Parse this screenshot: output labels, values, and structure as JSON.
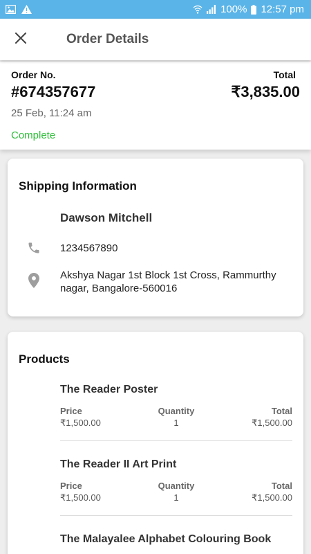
{
  "status_bar": {
    "battery": "100%",
    "time": "12:57 pm"
  },
  "app_bar": {
    "title": "Order Details"
  },
  "order": {
    "number_label": "Order No.",
    "number": "#674357677",
    "total_label": "Total",
    "total": "₹3,835.00",
    "date": "25 Feb, 11:24 am",
    "status": "Complete",
    "status_color": "#2fbf3a"
  },
  "shipping": {
    "title": "Shipping Information",
    "name": "Dawson Mitchell",
    "phone": "1234567890",
    "address_line1": "Akshya Nagar 1st Block 1st Cross, Rammurthy",
    "address_line2": "nagar, Bangalore-560016"
  },
  "products": {
    "title": "Products",
    "price_label": "Price",
    "quantity_label": "Quantity",
    "total_label": "Total",
    "items": [
      {
        "name": "The Reader Poster",
        "price": "₹1,500.00",
        "quantity": "1",
        "total": "₹1,500.00"
      },
      {
        "name": "The Reader II Art Print",
        "price": "₹1,500.00",
        "quantity": "1",
        "total": "₹1,500.00"
      },
      {
        "name": "The Malayalee Alphabet Colouring Book"
      }
    ]
  },
  "colors": {
    "status_bar": "#5ab4e8",
    "complete": "#2fbf3a"
  }
}
